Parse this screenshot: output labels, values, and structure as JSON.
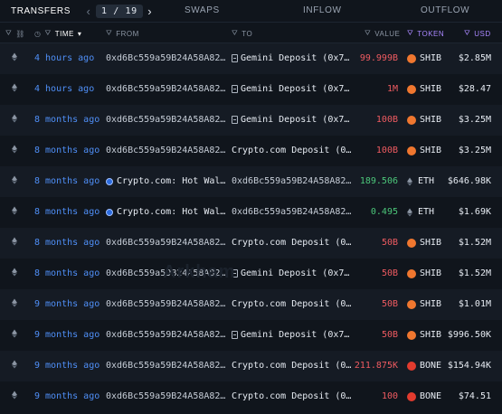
{
  "tabs": {
    "transfers": "TRANSFERS",
    "page": "1 / 19",
    "prev": "‹",
    "next": "›",
    "swaps": "SWAPS",
    "inflow": "INFLOW",
    "outflow": "OUTFLOW"
  },
  "header": {
    "time": "TIME",
    "from": "FROM",
    "to": "TO",
    "value": "VALUE",
    "token": "TOKEN",
    "usd": "USD"
  },
  "watermark": "Arkham",
  "rows": [
    {
      "time": "4 hours ago",
      "from": "0xd6Bc559a59B24A58A82…",
      "to": "Gemini Deposit (0x7…",
      "value": "99.999B",
      "token": "SHIB",
      "usd": "$2.85M"
    },
    {
      "time": "4 hours ago",
      "from": "0xd6Bc559a59B24A58A82…",
      "to": "Gemini Deposit (0x7…",
      "value": "1M",
      "token": "SHIB",
      "usd": "$28.47"
    },
    {
      "time": "8 months ago",
      "from": "0xd6Bc559a59B24A58A82…",
      "to": "Gemini Deposit (0x7…",
      "value": "100B",
      "token": "SHIB",
      "usd": "$3.25M"
    },
    {
      "time": "8 months ago",
      "from": "0xd6Bc559a59B24A58A82…",
      "to": "Crypto.com Deposit (0…",
      "value": "100B",
      "token": "SHIB",
      "usd": "$3.25M"
    },
    {
      "time": "8 months ago",
      "from": "Crypto.com: Hot Wal…",
      "to": "0xd6Bc559a59B24A58A82…",
      "value": "189.506",
      "token": "ETH",
      "usd": "$646.98K"
    },
    {
      "time": "8 months ago",
      "from": "Crypto.com: Hot Wal…",
      "to": "0xd6Bc559a59B24A58A82…",
      "value": "0.495",
      "token": "ETH",
      "usd": "$1.69K"
    },
    {
      "time": "8 months ago",
      "from": "0xd6Bc559a59B24A58A82…",
      "to": "Crypto.com Deposit (0…",
      "value": "50B",
      "token": "SHIB",
      "usd": "$1.52M"
    },
    {
      "time": "8 months ago",
      "from": "0xd6Bc559a59B24A58A82…",
      "to": "Gemini Deposit (0x7…",
      "value": "50B",
      "token": "SHIB",
      "usd": "$1.52M"
    },
    {
      "time": "9 months ago",
      "from": "0xd6Bc559a59B24A58A82…",
      "to": "Crypto.com Deposit (0…",
      "value": "50B",
      "token": "SHIB",
      "usd": "$1.01M"
    },
    {
      "time": "9 months ago",
      "from": "0xd6Bc559a59B24A58A82…",
      "to": "Gemini Deposit (0x7…",
      "value": "50B",
      "token": "SHIB",
      "usd": "$996.50K"
    },
    {
      "time": "9 months ago",
      "from": "0xd6Bc559a59B24A58A82…",
      "to": "Crypto.com Deposit (0…",
      "value": "211.875K",
      "token": "BONE",
      "usd": "$154.94K"
    },
    {
      "time": "9 months ago",
      "from": "0xd6Bc559a59B24A58A82…",
      "to": "Crypto.com Deposit (0…",
      "value": "100",
      "token": "BONE",
      "usd": "$74.51"
    }
  ],
  "row_meta": [
    {
      "from_kind": "address",
      "to_kind": "gemini",
      "dir": "out",
      "token_icon": "shib-icon"
    },
    {
      "from_kind": "address",
      "to_kind": "gemini",
      "dir": "out",
      "token_icon": "shib-icon"
    },
    {
      "from_kind": "address",
      "to_kind": "gemini",
      "dir": "out",
      "token_icon": "shib-icon"
    },
    {
      "from_kind": "address",
      "to_kind": "plain",
      "dir": "out",
      "token_icon": "shib-icon"
    },
    {
      "from_kind": "cryptocom",
      "to_kind": "address",
      "dir": "in",
      "token_icon": "eth-icon"
    },
    {
      "from_kind": "cryptocom",
      "to_kind": "address",
      "dir": "in",
      "token_icon": "eth-icon"
    },
    {
      "from_kind": "address",
      "to_kind": "plain",
      "dir": "out",
      "token_icon": "shib-icon"
    },
    {
      "from_kind": "address",
      "to_kind": "gemini",
      "dir": "out",
      "token_icon": "shib-icon"
    },
    {
      "from_kind": "address",
      "to_kind": "plain",
      "dir": "out",
      "token_icon": "shib-icon"
    },
    {
      "from_kind": "address",
      "to_kind": "gemini",
      "dir": "out",
      "token_icon": "shib-icon"
    },
    {
      "from_kind": "address",
      "to_kind": "plain",
      "dir": "out",
      "token_icon": "bone-icon"
    },
    {
      "from_kind": "address",
      "to_kind": "plain",
      "dir": "out",
      "token_icon": "bone-icon"
    }
  ],
  "colors": {
    "out": "#ef5b61",
    "in": "#4cc77a",
    "link": "#4f8ff7",
    "accent": "#a987ff"
  }
}
